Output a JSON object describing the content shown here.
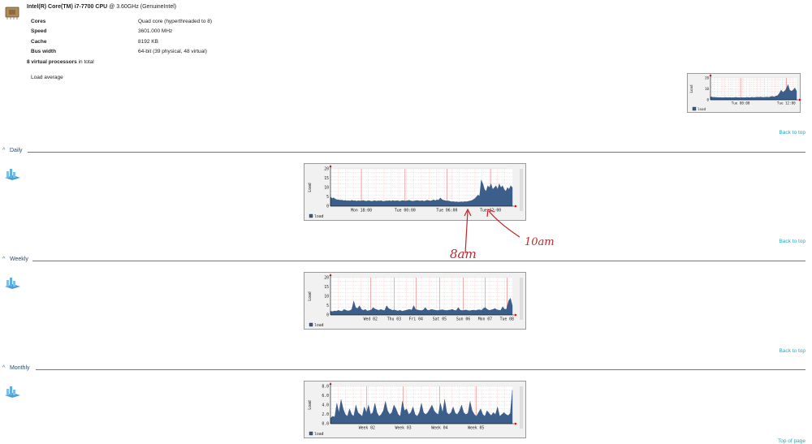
{
  "cpu": {
    "name": "Intel(R) Core(TM) i7-7700 CPU",
    "speed_suffix": "@ 3.60GHz (GenuineIntel)",
    "rows": [
      {
        "label": "Cores",
        "value": "Quad core (hyperthreaded to 8)"
      },
      {
        "label": "Speed",
        "value": "3601.000 MHz"
      },
      {
        "label": "Cache",
        "value": "8192 KB"
      },
      {
        "label": "Bus width",
        "value": "64-bit (39 physical, 48 virtual)"
      }
    ],
    "virtual_count": "8 virtual processors",
    "virtual_suffix": "in total",
    "load_average_label": "Load average"
  },
  "links": {
    "back_to_top": "Back to top",
    "top_of_page": "Top of page"
  },
  "sections": {
    "daily": "Daily",
    "weekly": "Weekly",
    "monthly": "Monthly"
  },
  "annotations": {
    "left": "8am",
    "right": "10am"
  },
  "colors": {
    "series": "#3b5f8a",
    "grid": "#f2b8b8",
    "accent": "#2aa7b7",
    "section": "#4d7fa8",
    "ink": "#c4242b"
  },
  "chart_data": [
    {
      "type": "area",
      "id": "summary",
      "ylim": [
        0,
        20
      ],
      "yticks": [
        "20",
        "10",
        "0"
      ],
      "ylabel": "Load",
      "x_tick_labels": [
        "Tue 00:00",
        "Tue 12:00"
      ],
      "x_tick_positions": [
        0.35,
        0.88
      ],
      "legend": [
        "load"
      ],
      "values": [
        3,
        2.5,
        2.4,
        2.3,
        2.2,
        2.1,
        2.2,
        2,
        2.1,
        2.3,
        2,
        2.2,
        2.1,
        2,
        2.2,
        2.3,
        2.1,
        2,
        2.2,
        2.1,
        2,
        2.3,
        2.2,
        2.1,
        2.4,
        2.2,
        2.3,
        2.5,
        2.4,
        2.6,
        2.4,
        2.3,
        2.5,
        2.6,
        2.4,
        3,
        3.2,
        2.8,
        3.5,
        4,
        6,
        9,
        7,
        8,
        10,
        14,
        9,
        8,
        9,
        11,
        8
      ]
    },
    {
      "type": "area",
      "id": "daily",
      "ylim": [
        0,
        20
      ],
      "yticks": [
        "20",
        "15",
        "10",
        "5",
        "0"
      ],
      "ylabel": "Load",
      "x_tick_labels": [
        "Mon 18:00",
        "Tue 00:00",
        "Tue 06:00",
        "Tue 12:00"
      ],
      "x_tick_positions": [
        0.17,
        0.41,
        0.64,
        0.88
      ],
      "legend": [
        "load"
      ],
      "values": [
        5,
        4.2,
        4.5,
        3.8,
        3.5,
        3.4,
        3.2,
        3.3,
        3,
        3.1,
        2.9,
        3,
        2.8,
        3.2,
        2.9,
        3,
        2.7,
        3,
        2.8,
        2.9,
        3.1,
        2.8,
        2.7,
        3,
        2.9,
        2.6,
        2.8,
        3,
        2.7,
        2.9,
        2.8,
        3,
        2.6,
        2.7,
        2.9,
        2.8,
        3,
        2.7,
        3.1,
        2.8,
        2.9,
        3,
        2.7,
        2.8,
        3.1,
        2.9,
        2.8,
        3,
        3.2,
        2.9,
        2.7,
        2.8,
        3,
        3.1,
        2.9,
        2.8,
        3,
        2.7,
        2.9,
        3.2,
        3,
        2.8,
        3.1,
        3.4,
        3,
        3.5,
        3.2,
        4.5,
        3.6,
        3.2,
        3,
        2.8,
        2.9,
        2.6,
        2.4,
        2.5,
        2.3,
        2.4,
        2.2,
        2.3,
        2.4,
        2.3,
        2.5,
        2.4,
        2.6,
        2.8,
        3,
        3.5,
        4,
        5,
        6,
        5.5,
        14,
        12,
        9,
        8,
        11,
        10,
        12,
        9,
        10,
        11,
        9,
        12,
        10,
        11,
        9,
        8,
        10,
        9,
        11,
        10
      ]
    },
    {
      "type": "area",
      "id": "weekly",
      "ylim": [
        0,
        20
      ],
      "yticks": [
        "20",
        "15",
        "10",
        "5",
        "0"
      ],
      "ylabel": "Load",
      "x_tick_labels": [
        "Wed 02",
        "Thu 03",
        "Fri 04",
        "Sat 05",
        "Sun 06",
        "Mon 07",
        "Tue 08"
      ],
      "x_tick_positions": [
        0.22,
        0.35,
        0.47,
        0.6,
        0.73,
        0.85,
        0.97
      ],
      "legend": [
        "load"
      ],
      "values": [
        2,
        1.8,
        2.2,
        2,
        2.5,
        2.2,
        2,
        3,
        2.5,
        2.2,
        2.4,
        3,
        7.5,
        4,
        3.5,
        5,
        3,
        2.5,
        3,
        2.2,
        2.4,
        2.6,
        4,
        3.2,
        2.8,
        2.5,
        3,
        2.6,
        2.4,
        5,
        3.5,
        3,
        2.5,
        2.7,
        2.4,
        2.2,
        2.6,
        2,
        2.3,
        2.5,
        2.8,
        3,
        2.6,
        5,
        3,
        2.7,
        2.5,
        2.4,
        2.7,
        4,
        2.6,
        2.5,
        3,
        2.8,
        2.6,
        2.4,
        2.5,
        2.7,
        2.8,
        2.5,
        2.4,
        2.6,
        2.7,
        3,
        2.5,
        2.4,
        4,
        2.6,
        2.4,
        2.5,
        2.7,
        2.4,
        2.3,
        2.5,
        2.6,
        2.4,
        2.7,
        2.8,
        2.5,
        3.5,
        4,
        3,
        2.5,
        2.7,
        3,
        3.5,
        2.8,
        2.6,
        2.5,
        4.5,
        3,
        3.2,
        7.5,
        9,
        5
      ]
    },
    {
      "type": "area",
      "id": "monthly",
      "ylim": [
        0,
        10
      ],
      "yticks": [
        "8.0",
        "6.0",
        "4.0",
        "2.0",
        "0.0"
      ],
      "ylabel": "Load",
      "x_tick_labels": [
        "Week 02",
        "Week 03",
        "Week 04",
        "Week 05"
      ],
      "x_tick_positions": [
        0.2,
        0.4,
        0.6,
        0.8
      ],
      "legend": [
        "load"
      ],
      "values": [
        1.5,
        2,
        1.8,
        5.5,
        3,
        6.5,
        4,
        2.5,
        2,
        4,
        2.5,
        2,
        5,
        3,
        2.5,
        2,
        4.5,
        3,
        5,
        2.5,
        3,
        5.5,
        3,
        2,
        2.5,
        3.5,
        6,
        3.5,
        2.5,
        3,
        5,
        4,
        2.5,
        2,
        6,
        3.5,
        4,
        2.5,
        3,
        4.5,
        2.5,
        2,
        3,
        5.5,
        3,
        2.5,
        3,
        4,
        5,
        3.5,
        2.8,
        2.5,
        5.5,
        3,
        6.5,
        3,
        2.5,
        3,
        4.5,
        2.8,
        2.5,
        3.5,
        5,
        3,
        2.5,
        2.8,
        6,
        3.5,
        2.5,
        2,
        3,
        4,
        2.5,
        2,
        3.5,
        2.8,
        2.2,
        3,
        2.5,
        4.5,
        2,
        2.5,
        3,
        2.5,
        2.2,
        2.8,
        9
      ]
    }
  ]
}
